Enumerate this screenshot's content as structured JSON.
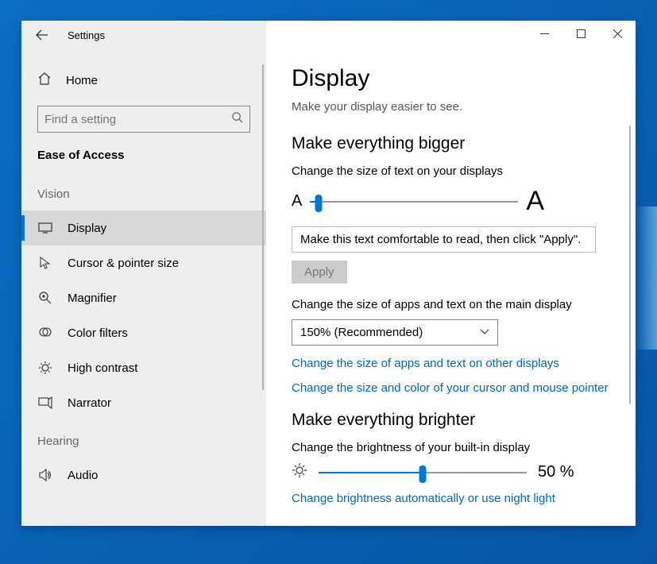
{
  "app": {
    "title": "Settings"
  },
  "sidebar": {
    "home": "Home",
    "search_placeholder": "Find a setting",
    "category": "Ease of Access",
    "groups": [
      {
        "label": "Vision",
        "items": [
          {
            "icon": "display",
            "label": "Display",
            "selected": true
          },
          {
            "icon": "cursor",
            "label": "Cursor & pointer size",
            "selected": false
          },
          {
            "icon": "magnifier",
            "label": "Magnifier",
            "selected": false
          },
          {
            "icon": "colorfilters",
            "label": "Color filters",
            "selected": false
          },
          {
            "icon": "highcontrast",
            "label": "High contrast",
            "selected": false
          },
          {
            "icon": "narrator",
            "label": "Narrator",
            "selected": false
          }
        ]
      },
      {
        "label": "Hearing",
        "items": [
          {
            "icon": "audio",
            "label": "Audio",
            "selected": false
          }
        ]
      }
    ]
  },
  "main": {
    "title": "Display",
    "subtitle": "Make your display easier to see.",
    "section_bigger": "Make everything bigger",
    "text_size_label": "Change the size of text on your displays",
    "text_slider": {
      "value": 4,
      "min": 0,
      "max": 100
    },
    "sample_text": "Make this text comfortable to read, then click \"Apply\".",
    "apply": "Apply",
    "apps_size_label": "Change the size of apps and text on the main display",
    "dropdown_value": "150% (Recommended)",
    "link_other_displays": "Change the size of apps and text on other displays",
    "link_cursor": "Change the size and color of your cursor and mouse pointer",
    "section_brighter": "Make everything brighter",
    "brightness_label": "Change the brightness of your built-in display",
    "brightness": {
      "value": 50,
      "display": "50 %"
    },
    "link_night": "Change brightness automatically or use night light"
  }
}
